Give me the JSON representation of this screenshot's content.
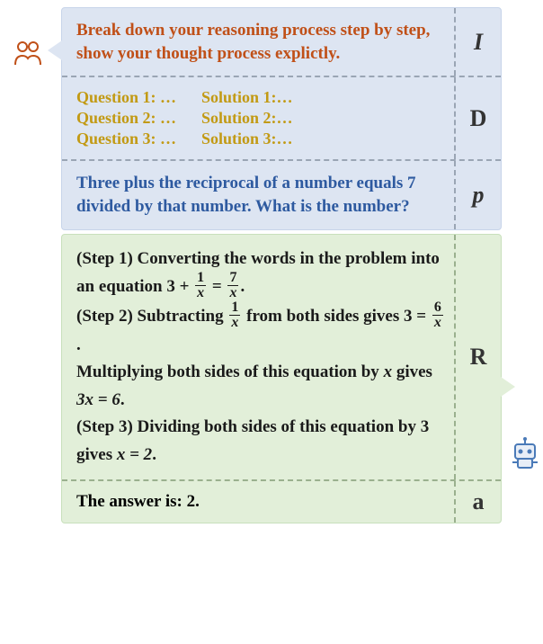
{
  "labels": {
    "I": "I",
    "D": "D",
    "p": "p",
    "R": "R",
    "a": "a"
  },
  "instruction": "Break down your reasoning process step by step, show your thought process explictly.",
  "demonstrations": {
    "questions": [
      "Question 1: …",
      "Question 2: …",
      "Question 3: …"
    ],
    "solutions": [
      "Solution 1:…",
      "Solution 2:…",
      "Solution 3:…"
    ]
  },
  "problem": "Three plus the reciprocal of a number equals 7 divided by that number. What is the number?",
  "reasoning": {
    "step1_prefix": "(Step 1) Converting the words in the problem into an equation ",
    "step1_eq_lhs": "3 + ",
    "step1_frac1_num": "1",
    "step1_frac1_den": "x",
    "step1_mid": " = ",
    "step1_frac2_num": "7",
    "step1_frac2_den": "x",
    "step1_end": ".",
    "step2_prefix": "(Step 2) Subtracting ",
    "step2_frac_num": "1",
    "step2_frac_den": "x",
    "step2_mid": " from both sides gives ",
    "step2_eq_lhs": "3 = ",
    "step2_frac2_num": "6",
    "step2_frac2_den": "x",
    "step2_end": ".",
    "step2b": "Multiplying both sides of this equation by ",
    "step2b_var": "x",
    "step2b_mid": " gives ",
    "step2b_eq": "3x = 6",
    "step2b_end": ".",
    "step3_prefix": "(Step 3) Dividing both sides of this equation by 3 gives ",
    "step3_eq": "x = 2",
    "step3_end": "."
  },
  "answer": "The answer is: 2.",
  "icons": {
    "user": "user-icon",
    "robot": "robot-icon"
  }
}
